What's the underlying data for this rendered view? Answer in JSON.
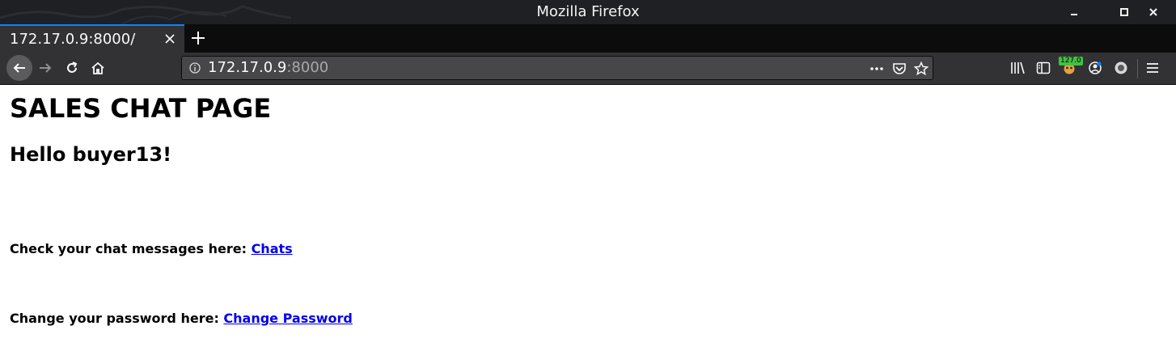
{
  "window": {
    "title": "Mozilla Firefox"
  },
  "tabs": [
    {
      "title": "172.17.0.9:8000/"
    }
  ],
  "address_bar": {
    "host": "172.17.0.9",
    "port": ":8000"
  },
  "toolbar": {
    "badge_text": "127.0"
  },
  "page": {
    "heading": "SALES CHAT PAGE",
    "greeting": "Hello buyer13!",
    "chats_prompt": "Check your chat messages here: ",
    "chats_link": "Chats",
    "password_prompt": "Change your password here: ",
    "password_link": "Change Password"
  },
  "colors": {
    "titlebar_bg": "#1f2023",
    "toolbar_bg": "#323234",
    "tab_accent": "#0a84ff",
    "link": "#0000ee"
  },
  "icons": [
    "minimize-icon",
    "maximize-icon",
    "close-window-icon",
    "tab-close-icon",
    "new-tab-icon",
    "back-icon",
    "forward-icon",
    "reload-icon",
    "home-icon",
    "site-info-icon",
    "page-actions-icon",
    "pocket-icon",
    "bookmark-star-icon",
    "library-icon",
    "sidebar-icon",
    "extension-icon",
    "account-icon",
    "extension-circle-icon",
    "menu-icon"
  ]
}
